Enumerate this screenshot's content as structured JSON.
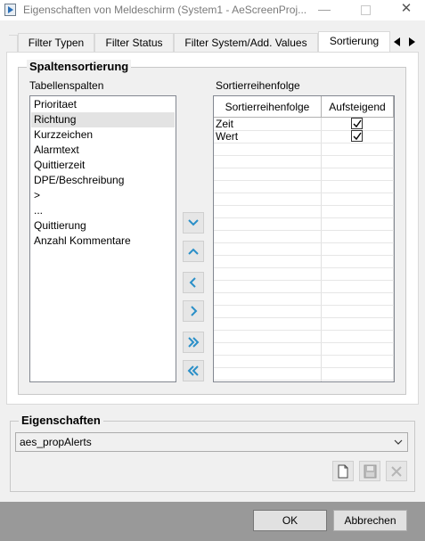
{
  "window": {
    "title": "Eigenschaften von Meldeschirm (System1 - AeScreenProj...",
    "minimize_glyph": "—",
    "close_glyph": "✕"
  },
  "tabs": [
    {
      "label": "Filter Typen",
      "active": false
    },
    {
      "label": "Filter Status",
      "active": false
    },
    {
      "label": "Filter System/Add. Values",
      "active": false
    },
    {
      "label": "Sortierung",
      "active": true
    }
  ],
  "sorting": {
    "group_title": "Spaltensortierung",
    "columns_label": "Tabellenspalten",
    "order_label": "Sortierreihenfolge",
    "columns": [
      "Prioritaet",
      "Richtung",
      "Kurzzeichen",
      "Alarmtext",
      "Quittierzeit",
      "DPE/Beschreibung",
      ">",
      "...",
      "Quittierung",
      "Anzahl Kommentare"
    ],
    "selected_column": "Richtung",
    "grid": {
      "headers": [
        "Sortierreihenfolge",
        "Aufsteigend"
      ],
      "rows": [
        {
          "name": "Zeit",
          "ascending": true
        },
        {
          "name": "Wert",
          "ascending": true
        }
      ]
    }
  },
  "properties": {
    "group_title": "Eigenschaften",
    "selected": "aes_propAlerts"
  },
  "footer": {
    "ok_label": "OK",
    "cancel_label": "Abbrechen"
  },
  "colors": {
    "selection": "#e3e3e3",
    "move_arrow": "#2a8fc8",
    "footer": "#999999"
  },
  "icons": {
    "move_buttons": [
      "chevron-down-icon",
      "chevron-up-icon",
      "chevron-left-icon",
      "chevron-right-icon",
      "double-chevron-right-icon",
      "double-chevron-left-icon"
    ],
    "tool_buttons": [
      "new-document-icon",
      "save-icon",
      "delete-icon"
    ]
  }
}
